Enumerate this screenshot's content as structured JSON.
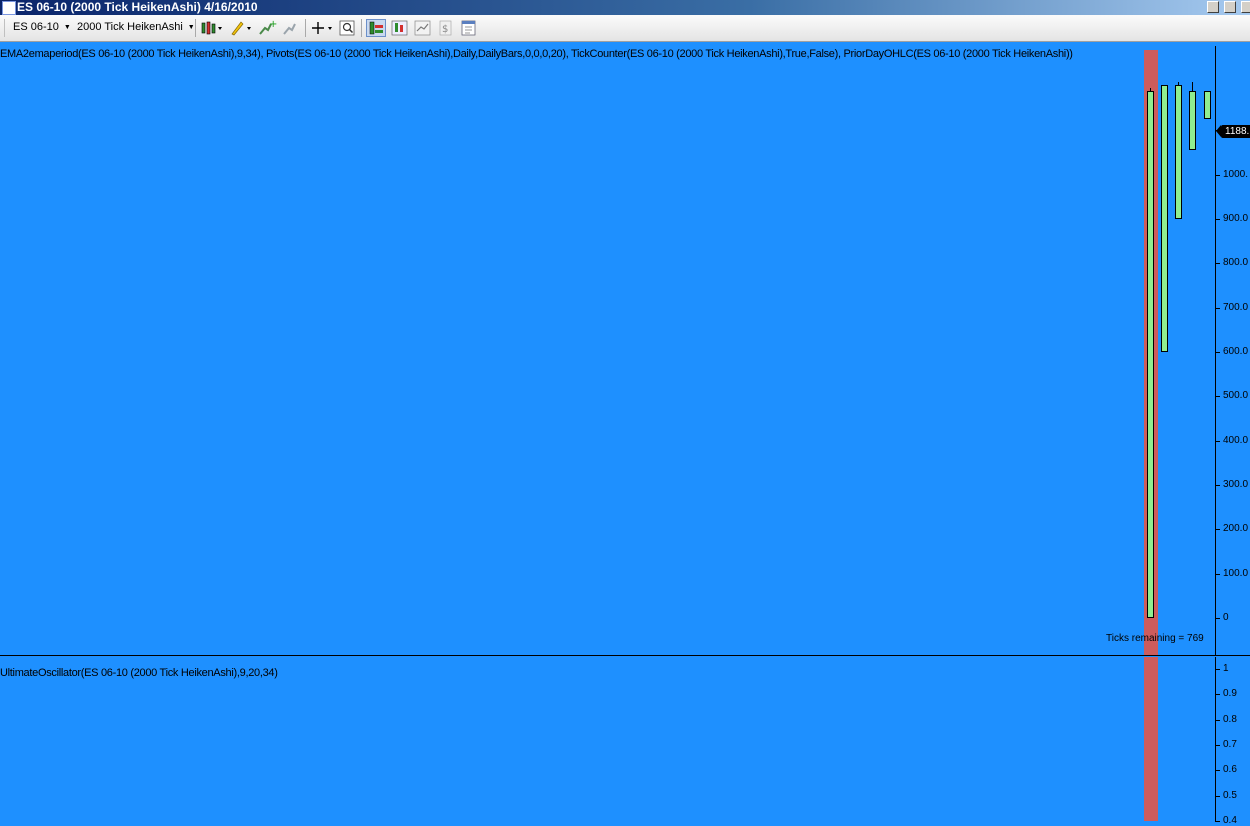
{
  "window": {
    "title": "ES 06-10 (2000 Tick HeikenAshi)  4/16/2010"
  },
  "toolbar": {
    "instrument": "ES 06-10",
    "period": "2000 Tick HeikenAshi",
    "icons": [
      "bar-type-icon",
      "drawing-tool-icon",
      "add-indicator-icon",
      "remove-indicator-icon",
      "crosshair-icon",
      "zoom-icon",
      "properties-icon",
      "chart-style-icon",
      "chart-trader-icon",
      "dollar-icon",
      "data-box-icon"
    ]
  },
  "colors": {
    "background": "#1e90ff",
    "session_band": "#cd5c5c",
    "up_candle": "#90ee90"
  },
  "price_panel": {
    "label": "EMA2emaperiod(ES 06-10 (2000 Tick HeikenAshi),9,34), Pivots(ES 06-10 (2000 Tick HeikenAshi),Daily,DailyBars,0,0,0,20), TickCounter(ES 06-10 (2000 Tick HeikenAshi),True,False), PriorDayOHLC(ES 06-10 (2000 Tick HeikenAshi))",
    "current_price": "1188.",
    "ticks_remaining": "Ticks remaining = 769",
    "axis_labels": [
      "1100.",
      "1000.",
      "900.0",
      "800.0",
      "700.0",
      "600.0",
      "500.0",
      "400.0",
      "300.0",
      "200.0",
      "100.0",
      "0"
    ]
  },
  "indicator_panel": {
    "label": "UltimateOscillator(ES 06-10 (2000 Tick HeikenAshi),9,20,34)",
    "axis_labels": [
      "1",
      "0.9",
      "0.8",
      "0.7",
      "0.6",
      "0.5",
      "0.4"
    ]
  },
  "chart_data": {
    "type": "candlestick",
    "ylim": [
      0,
      1200
    ],
    "candles": [
      {
        "open": 0,
        "close": 1188,
        "high": 1195,
        "low": 0
      },
      {
        "open": 600,
        "close": 1203,
        "high": 1203,
        "low": 600
      },
      {
        "open": 900,
        "close": 1203,
        "high": 1210,
        "low": 900
      },
      {
        "open": 1055,
        "close": 1188,
        "high": 1210,
        "low": 1055
      },
      {
        "open": 1125,
        "close": 1188,
        "high": 1188,
        "low": 1125
      }
    ]
  }
}
